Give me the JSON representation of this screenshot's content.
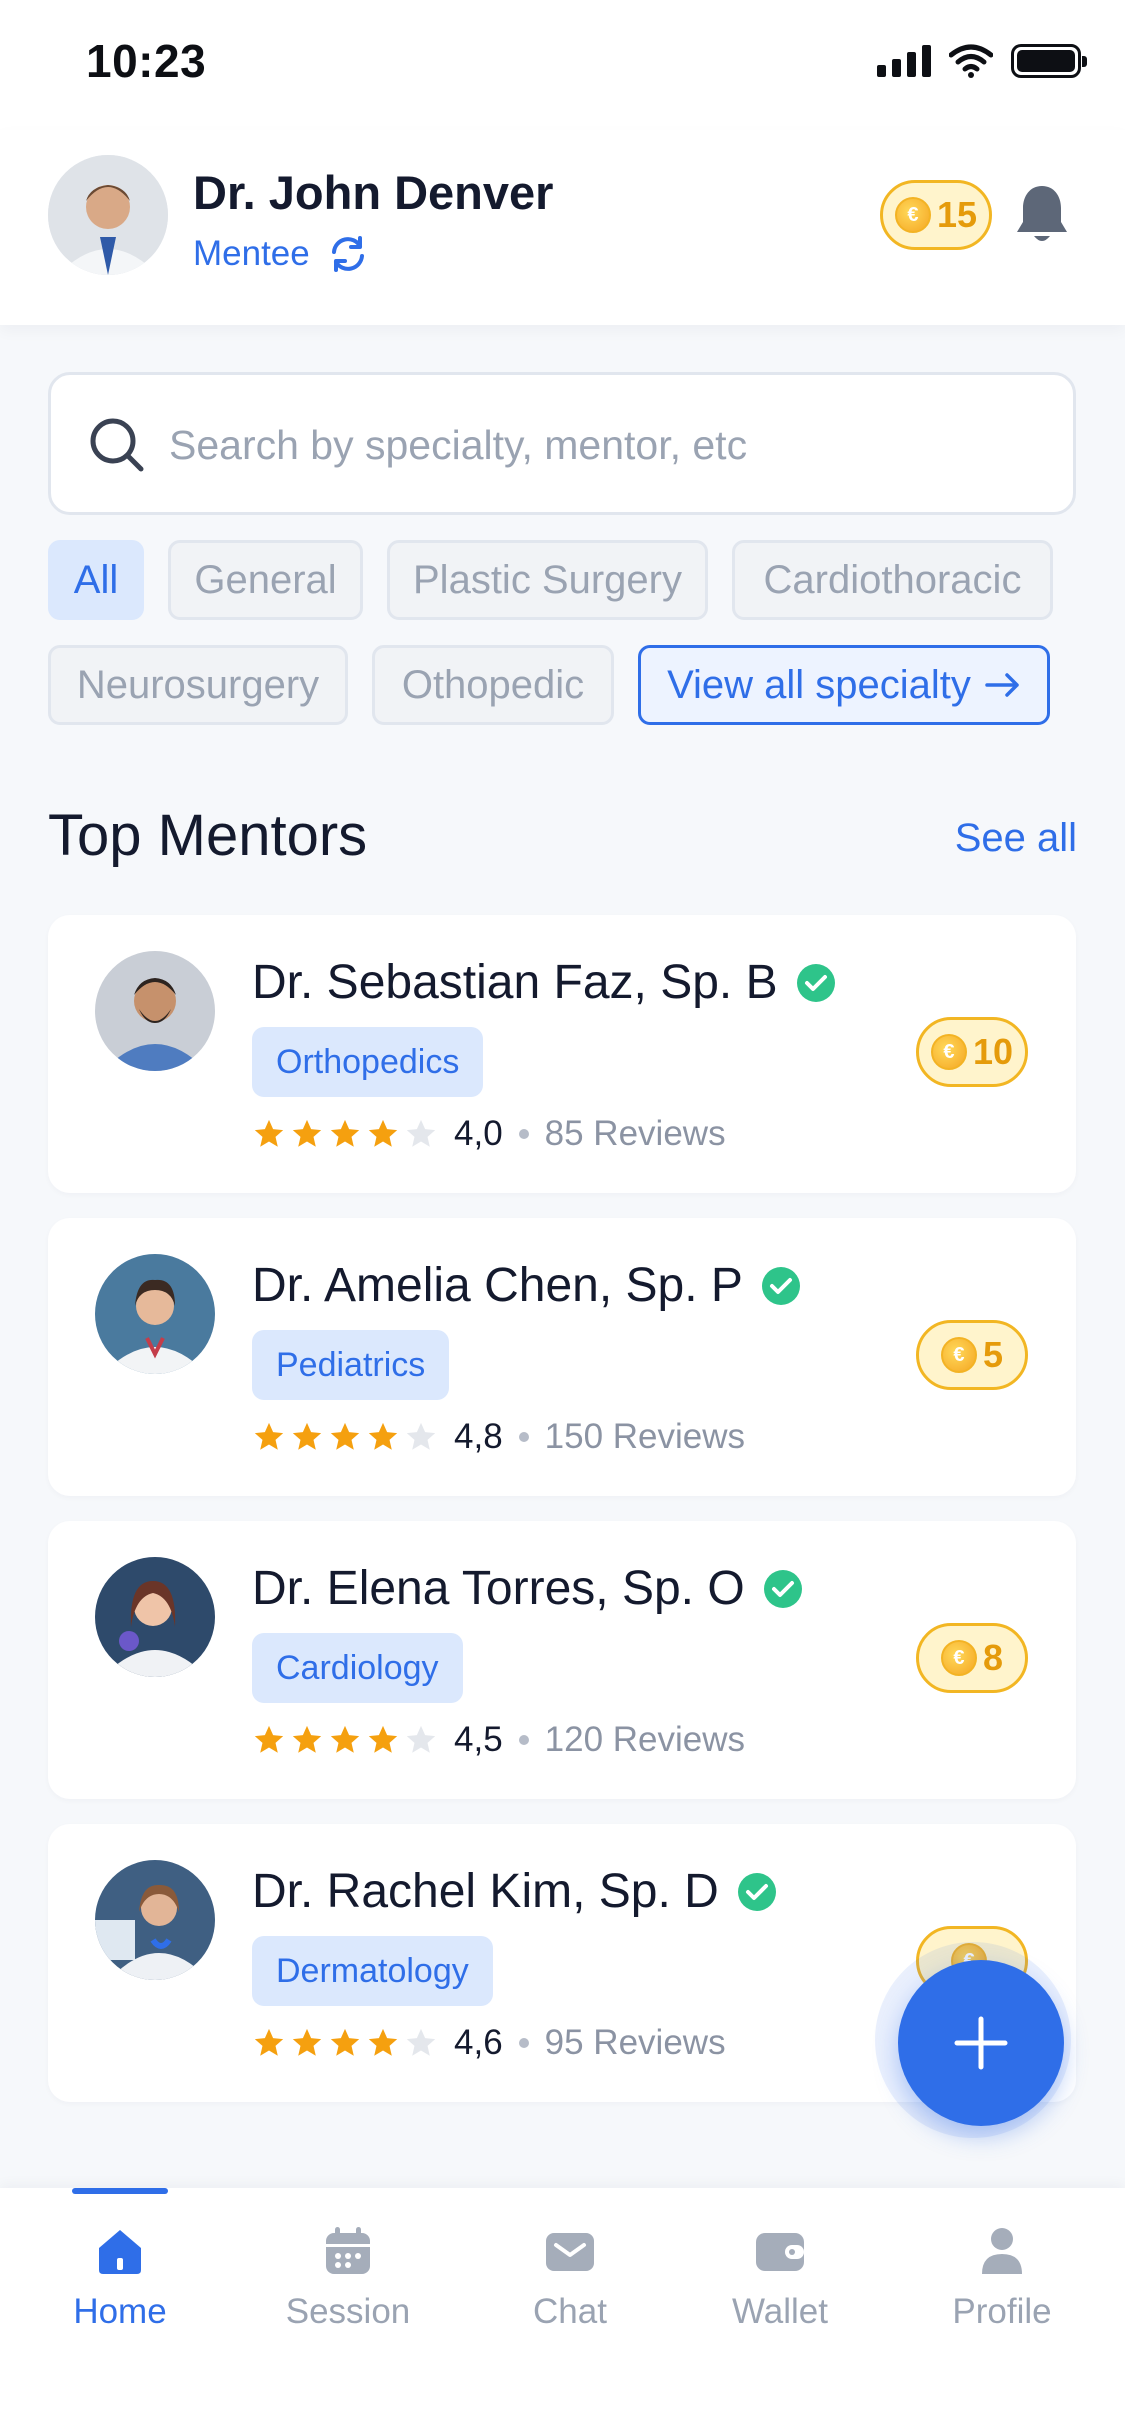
{
  "status_bar": {
    "time": "10:23"
  },
  "header": {
    "name": "Dr. John Denver",
    "role": "Mentee",
    "coins": "15"
  },
  "search": {
    "placeholder": "Search by specialty, mentor, etc"
  },
  "chips": [
    {
      "label": "All"
    },
    {
      "label": "General"
    },
    {
      "label": "Plastic Surgery"
    },
    {
      "label": "Cardiothoracic"
    },
    {
      "label": "Neurosurgery"
    },
    {
      "label": "Othopedic"
    },
    {
      "label": "View all specialty"
    }
  ],
  "section": {
    "title": "Top Mentors",
    "see_all": "See all"
  },
  "mentors": [
    {
      "name": "Dr. Sebastian Faz, Sp. B",
      "specialty": "Orthopedics",
      "rating": "4,0",
      "stars": 4,
      "reviews": "85 Reviews",
      "coins": "10"
    },
    {
      "name": "Dr. Amelia Chen, Sp. P",
      "specialty": "Pediatrics",
      "rating": "4,8",
      "stars": 4,
      "reviews": "150 Reviews",
      "coins": "5"
    },
    {
      "name": "Dr. Elena Torres, Sp. O",
      "specialty": "Cardiology",
      "rating": "4,5",
      "stars": 4,
      "reviews": "120 Reviews",
      "coins": "8"
    },
    {
      "name": "Dr. Rachel Kim, Sp. D",
      "specialty": "Dermatology",
      "rating": "4,6",
      "stars": 4,
      "reviews": "95 Reviews",
      "coins": ""
    }
  ],
  "nav": [
    {
      "label": "Home",
      "icon": "home-icon",
      "active": true
    },
    {
      "label": "Session",
      "icon": "calendar-icon",
      "active": false
    },
    {
      "label": "Chat",
      "icon": "mail-icon",
      "active": false
    },
    {
      "label": "Wallet",
      "icon": "wallet-icon",
      "active": false
    },
    {
      "label": "Profile",
      "icon": "person-icon",
      "active": false
    }
  ],
  "colors": {
    "accent": "#2f6ee8",
    "coin": "#f2b623",
    "star": "#f5a00f",
    "verified": "#2ec48a"
  }
}
